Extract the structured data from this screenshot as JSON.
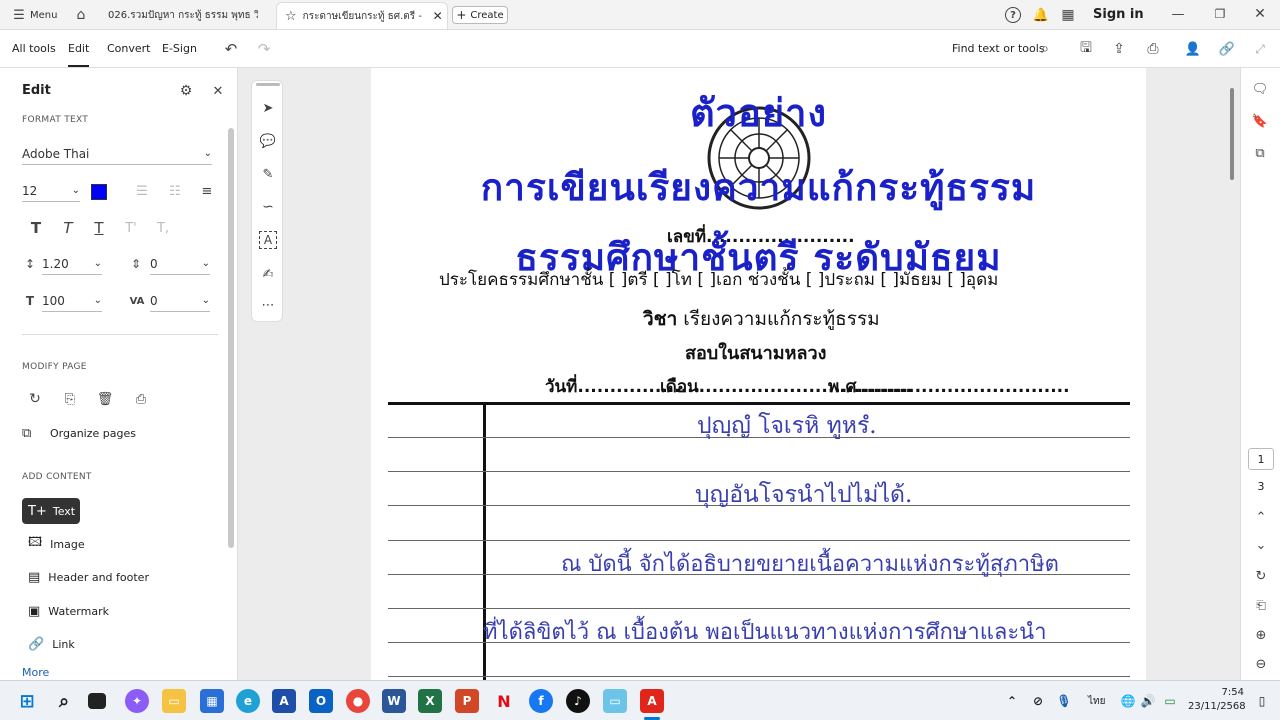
{
  "tabs": {
    "menu": "Menu",
    "tab1": "026.รวมปัญหา กระทู้ ธรรม พุทธ วินัย ต...",
    "tab2": "กระดาษเขียนกระทู้ ธศ.ตรี - C...",
    "create": "Create",
    "signin": "Sign in"
  },
  "toolbar": {
    "all_tools": "All tools",
    "edit": "Edit",
    "convert": "Convert",
    "esign": "E-Sign",
    "find": "Find text or tools"
  },
  "panel": {
    "title": "Edit",
    "format_text": "FORMAT TEXT",
    "font": "Adobe Thai",
    "size": "12",
    "line_spacing": "1.20",
    "para_spacing": "0",
    "scale": "100",
    "char_spacing": "0",
    "text_color": "#0000ff",
    "modify_page": "MODIFY PAGE",
    "organize": "Organize pages",
    "add_content": "ADD CONTENT",
    "items": [
      "Text",
      "Image",
      "Header and footer",
      "Watermark",
      "Link"
    ],
    "more": "More"
  },
  "document": {
    "title1": "ตัวอย่าง",
    "title2": "การเขียนเรียงความแก้กระทู้ธรรม",
    "title3": "ธรรมศึกษาชั้นตรี ระดับมัธยม",
    "number": "เลขที่.......................",
    "class_line": "ประโยคธรรมศึกษาชั้น [ ]ตรี [ ]โท [ ]เอก ช่วงชั้น [ ]ประถม [ ]มัธยม [ ]อุดม",
    "subject_label": "วิชา",
    "subject": "เรียงความแก้กระทู้ธรรม",
    "exam": "สอบในสนามหลวง",
    "date_day": "วันที่...................",
    "date_month": "เดือน.................................",
    "date_year": "พ.ศ.................................",
    "lines": [
      "ปุญฺญํ โจเรหิ ทูหรํ.",
      "บุญอันโจรนำไปไม่ได้.",
      "ณ บัดนี้ จักได้อธิบายขยายเนื้อความแห่งกระทู้สุภาษิต",
      "ที่ได้ลิขิตไว้ ณ เบื้องต้น พอเป็นแนวทางแห่งการศึกษาและนำ"
    ]
  },
  "rightbar": {
    "page_current": "1",
    "page_total": "3"
  },
  "taskbar": {
    "lang": "ไทย",
    "time": "7:54",
    "date": "23/11/2568"
  },
  "colors": {
    "title_blue": "#1a21c9",
    "hand_blue": "#3a3fb0"
  }
}
